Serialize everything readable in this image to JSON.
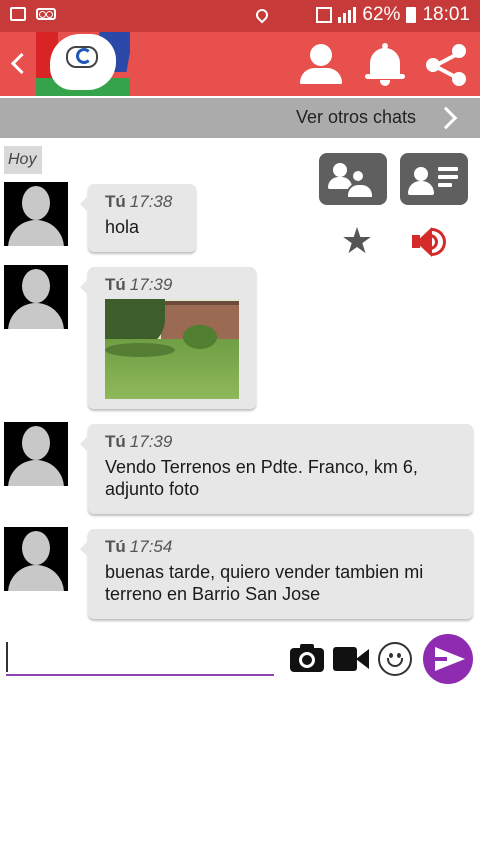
{
  "status_bar": {
    "battery": "62%",
    "time": "18:01",
    "icons": [
      "image-icon",
      "voicemail-icon",
      "location-icon",
      "mute-icon",
      "wifi-icon",
      "sim-icon",
      "signal-icon",
      "battery-icon"
    ]
  },
  "app_bar": {
    "icons": [
      "back-icon",
      "logo",
      "person-icon",
      "bell-icon",
      "share-icon"
    ],
    "color": "#e8504e"
  },
  "other_chats": {
    "label": "Ver otros chats"
  },
  "chat": {
    "date_label": "Hoy",
    "messages": [
      {
        "author": "Tú",
        "time": "17:38",
        "text": "hola"
      },
      {
        "author": "Tú",
        "time": "17:39",
        "image": "photo of a house and grassy yard"
      },
      {
        "author": "Tú",
        "time": "17:39",
        "text": "Vendo Terrenos en Pdte. Franco, km 6, adjunto foto"
      },
      {
        "author": "Tú",
        "time": "17:54",
        "text": "buenas tarde, quiero vender tambien mi terreno en Barrio San Jose"
      }
    ]
  },
  "side_actions": {
    "icons": [
      "group-icon",
      "contact-card-icon",
      "star-icon",
      "speaker-icon"
    ],
    "speaker_color": "#d42a2a"
  },
  "composer": {
    "input_value": "",
    "input_placeholder": "",
    "accent": "#8e44ad",
    "icons": [
      "camera-icon",
      "video-icon",
      "emoji-icon",
      "send-icon"
    ]
  }
}
